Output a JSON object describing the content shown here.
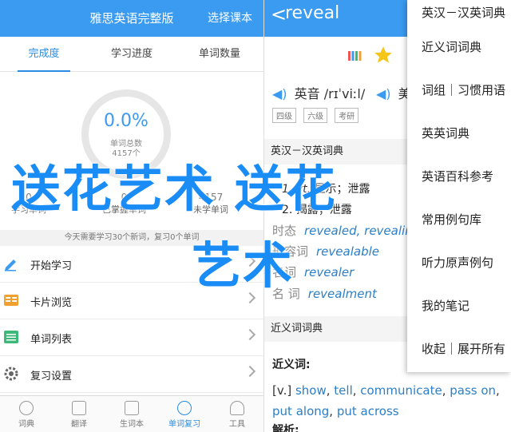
{
  "left": {
    "header": {
      "title": "雅思英语完整版",
      "action": "选择课本"
    },
    "tabs": [
      {
        "label": "完成度"
      },
      {
        "label": "学习进度"
      },
      {
        "label": "单词数量"
      }
    ],
    "progress": {
      "percent": "0.0%",
      "label": "单词总数",
      "total": "4157个"
    },
    "stats": [
      {
        "num": "0",
        "label": "学习单词"
      },
      {
        "num": "0",
        "label": "已掌握单词"
      },
      {
        "num": "4157",
        "label": "未学单词"
      }
    ],
    "tip": "今天需要学习30个新词，复习0个单词",
    "menu": [
      {
        "label": "开始学习"
      },
      {
        "label": "卡片浏览"
      },
      {
        "label": "单词列表"
      },
      {
        "label": "复习设置"
      }
    ],
    "bottom_nav": [
      {
        "label": "词典"
      },
      {
        "label": "翻译"
      },
      {
        "label": "生词本"
      },
      {
        "label": "单词复习"
      },
      {
        "label": "工具"
      }
    ]
  },
  "right": {
    "header": {
      "back": "<",
      "word": "reveal"
    },
    "pron_us": {
      "label": "英音",
      "ipa": "/rɪˈviːl/"
    },
    "pron_uk": {
      "label": "美"
    },
    "tags": [
      "四级",
      "六级",
      "考研"
    ],
    "section_en_cn": "英汉－汉英词典",
    "defs": [
      {
        "pos": "1. vt.",
        "text": "显示；泄露"
      },
      {
        "pos": "2.",
        "text": "揭露；泄露"
      }
    ],
    "forms": [
      {
        "label": "时态",
        "value": "revealed, revealing"
      },
      {
        "label": "形容词",
        "value": "revealable"
      },
      {
        "label": "名词",
        "value": "revealer"
      },
      {
        "label": "名 词",
        "value": "revealment"
      }
    ],
    "section_syn": "近义词词典",
    "syn_heading": "近义词:",
    "syn_prefix": "[v.]",
    "synonyms": [
      "show",
      "tell",
      "communicate",
      "pass on",
      "put",
      "along",
      "put across"
    ],
    "phrase_heading": "解析:"
  },
  "dropdown": {
    "items": [
      {
        "label": "英汉－汉英词典"
      },
      {
        "label": "近义词词典"
      },
      {
        "label": "词组｜习惯用语"
      },
      {
        "label": "英英词典"
      },
      {
        "label": "英语百科参考"
      },
      {
        "label": "常用例句库"
      },
      {
        "label": "听力原声例句"
      },
      {
        "label": "我的笔记"
      },
      {
        "label": "收起｜展开所有"
      }
    ]
  },
  "watermark": {
    "line1": "送花艺术 送花",
    "line2": "艺术"
  },
  "colors": {
    "primary": "#3a9bf0",
    "link": "#2b7fc8",
    "watermark": "#1a8cf5"
  }
}
